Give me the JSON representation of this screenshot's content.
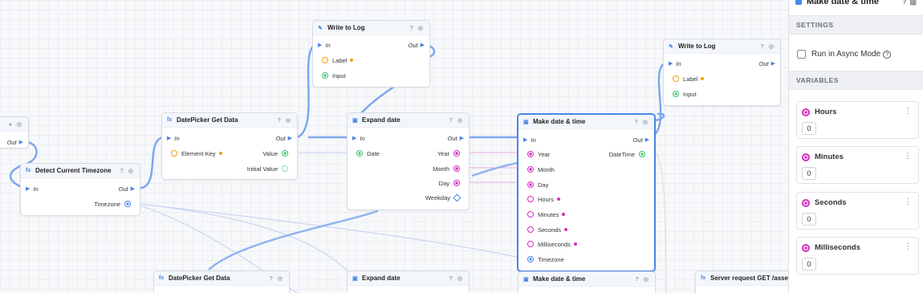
{
  "canvas": {
    "nodes": {
      "log1": {
        "title": "Write to Log",
        "in": "In",
        "out": "Out",
        "label": "Label",
        "input": "Input"
      },
      "partial": {
        "out": "Out"
      },
      "tz": {
        "title": "Detect Current Timezone",
        "in": "In",
        "out": "Out",
        "timezone": "Timezone"
      },
      "dp1": {
        "title": "DatePicker Get Data",
        "in": "In",
        "out": "Out",
        "element_key": "Element Key",
        "value": "Value",
        "initial_value": "Initial Value"
      },
      "expand1": {
        "title": "Expand date",
        "in": "In",
        "out": "Out",
        "date": "Date",
        "year": "Year",
        "month": "Month",
        "day": "Day",
        "weekday": "Weekday"
      },
      "make1": {
        "title": "Make date & time",
        "in": "In",
        "out": "Out",
        "datetime": "DateTime",
        "year": "Year",
        "month": "Month",
        "day": "Day",
        "hours": "Hours",
        "minutes": "Minutes",
        "seconds": "Seconds",
        "milliseconds": "Milliseconds",
        "timezone": "Timezone"
      },
      "log2": {
        "title": "Write to Log",
        "in": "In",
        "out": "Out",
        "label": "Label",
        "input": "Input"
      },
      "dp2": {
        "title": "DatePicker Get Data"
      },
      "expand2": {
        "title": "Expand date"
      },
      "make2": {
        "title": "Make date & time"
      },
      "server": {
        "title": "Server request GET /asset"
      }
    }
  },
  "panel": {
    "title": "Make date & time",
    "settings_label": "SETTINGS",
    "async_label": "Run in Async Mode",
    "async_checked": false,
    "help_icon": "question-circle-icon",
    "variables_label": "VARIABLES",
    "variables": [
      {
        "name": "Hours",
        "value": "0"
      },
      {
        "name": "Minutes",
        "value": "0"
      },
      {
        "name": "Seconds",
        "value": "0"
      },
      {
        "name": "Milliseconds",
        "value": "0"
      }
    ]
  },
  "colors": {
    "accent": "#4a86e8",
    "number_port": "#d62fbf",
    "string_port": "#f0a000",
    "any_port": "#3cbf6b"
  }
}
